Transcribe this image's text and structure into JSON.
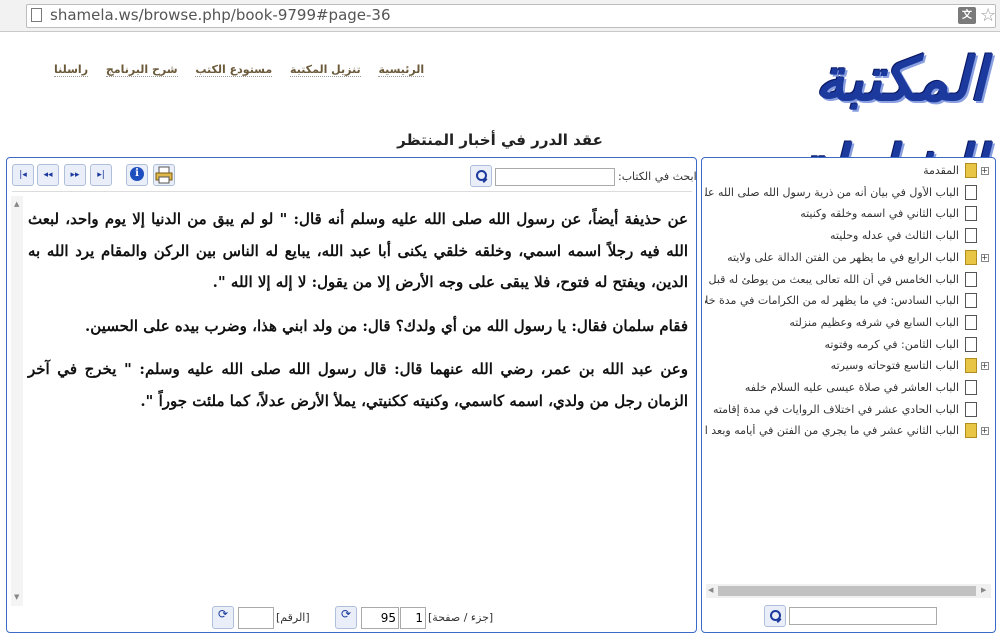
{
  "browser": {
    "url": "shamela.ws/browse.php/book-9799#page-36"
  },
  "site": {
    "logo_text": "المكتبة الشاملة",
    "nav": [
      "الرئيسية",
      "تنزيل المكتبة",
      "مستودع الكتب",
      "شرح البرنامج",
      "راسلنا"
    ]
  },
  "book": {
    "title": "عقد الدرر في أخبار المنتظر"
  },
  "toolbar": {
    "search_label": "ابحث في الكتاب:",
    "search_value": "",
    "first_icon": "|◂",
    "prev_icon": "◂◂",
    "next_icon": "▸▸",
    "last_icon": "▸|",
    "info_icon": "i"
  },
  "content": {
    "paragraphs": [
      "عن حذيفة أيضاً، عن رسول الله صلى الله عليه وسلم أنه قال: \" لو لم يبق من الدنيا إلا يوم واحد، لبعث الله فيه رجلاً اسمه اسمي، وخلقه خلقي يكنى أبا عبد الله، يبايع له الناس بين الركن والمقام يرد الله به الدين، ويفتح له فتوح، فلا يبقى على وجه الأرض إلا من يقول: لا إله إلا الله \".",
      "فقام سلمان فقال: يا رسول الله من أي ولدك؟ قال: من ولد ابني هذا، وضرب بيده على الحسين.",
      "وعن عبد الله بن عمر، رضي الله عنهما قال: قال رسول الله صلى الله عليه وسلم: \" يخرج في آخر الزمان رجل من ولدي، اسمه كاسمي، وكنيته ككنيتي، يملأ الأرض عدلاً، كما ملئت جوراً \"."
    ]
  },
  "pager": {
    "juz_page_label": "[جزء / صفحة]",
    "juz": "1",
    "page": "95",
    "number_label": "[الرقم]",
    "number": "",
    "go_icon": "⟳"
  },
  "toc": {
    "items": [
      {
        "label": "المقدمة",
        "type": "folder",
        "expandable": true
      },
      {
        "label": "الباب الأول في بيان أنه من ذرية رسول الله صلى الله عليه و",
        "type": "page",
        "expandable": false
      },
      {
        "label": "الباب الثاني في اسمه وخلقه وكنيته",
        "type": "page",
        "expandable": false
      },
      {
        "label": "الباب الثالث في عدله وحليته",
        "type": "page",
        "expandable": false
      },
      {
        "label": "الباب الرابع في ما يظهر من الفتن الدالة على ولايته",
        "type": "folder",
        "expandable": true
      },
      {
        "label": "الباب الخامس في أن الله تعالى يبعث من يوطئ له قبل إما",
        "type": "page",
        "expandable": false
      },
      {
        "label": "الباب السادس: في ما يظهر له من الكرامات في مدة خلافة",
        "type": "page",
        "expandable": false
      },
      {
        "label": "الباب السابع في شرفه وعظيم منزلته",
        "type": "page",
        "expandable": false
      },
      {
        "label": "الباب الثامن: في كرمه وفتوته",
        "type": "page",
        "expandable": false
      },
      {
        "label": "الباب التاسع فتوحاته وسيرته",
        "type": "folder",
        "expandable": true
      },
      {
        "label": "الباب العاشر في صلاة عيسى عليه السلام خلفه",
        "type": "page",
        "expandable": false
      },
      {
        "label": "الباب الحادي عشر في اختلاف الروايات في مدة إقامته",
        "type": "page",
        "expandable": false
      },
      {
        "label": "الباب الثاني عشر في ما يجري من الفتن في أيامه وبعد انة",
        "type": "folder",
        "expandable": true
      }
    ],
    "search_value": ""
  }
}
